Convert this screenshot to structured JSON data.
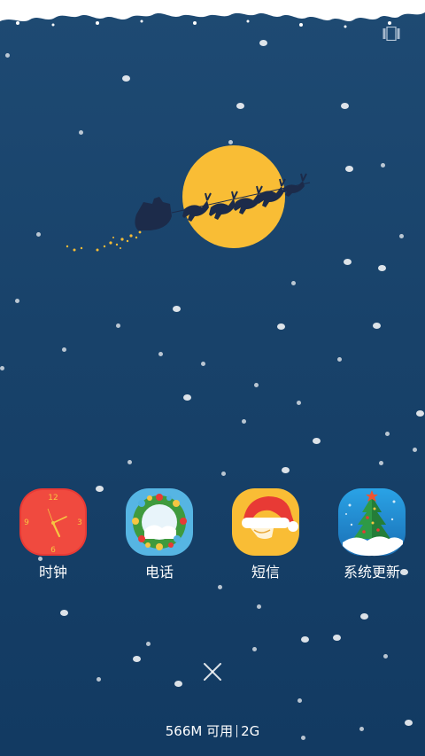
{
  "apps": [
    {
      "label": "时钟",
      "icon": "clock-icon"
    },
    {
      "label": "电话",
      "icon": "phone-wreath-icon"
    },
    {
      "label": "短信",
      "icon": "messages-santa-hat-icon"
    },
    {
      "label": "系统更新",
      "icon": "system-update-tree-icon"
    }
  ],
  "memory": {
    "available": "566M 可用",
    "total": "2G"
  },
  "clock_face": {
    "n12": "12",
    "n3": "3",
    "n6": "6",
    "n9": "9"
  },
  "colors": {
    "background": "#18426a",
    "moon": "#f9bd35",
    "clock_red": "#e83a35",
    "wreath_blue": "#4fb1e0",
    "hat_yellow": "#f9bd35",
    "tree_blue": "#2f8fd0"
  }
}
